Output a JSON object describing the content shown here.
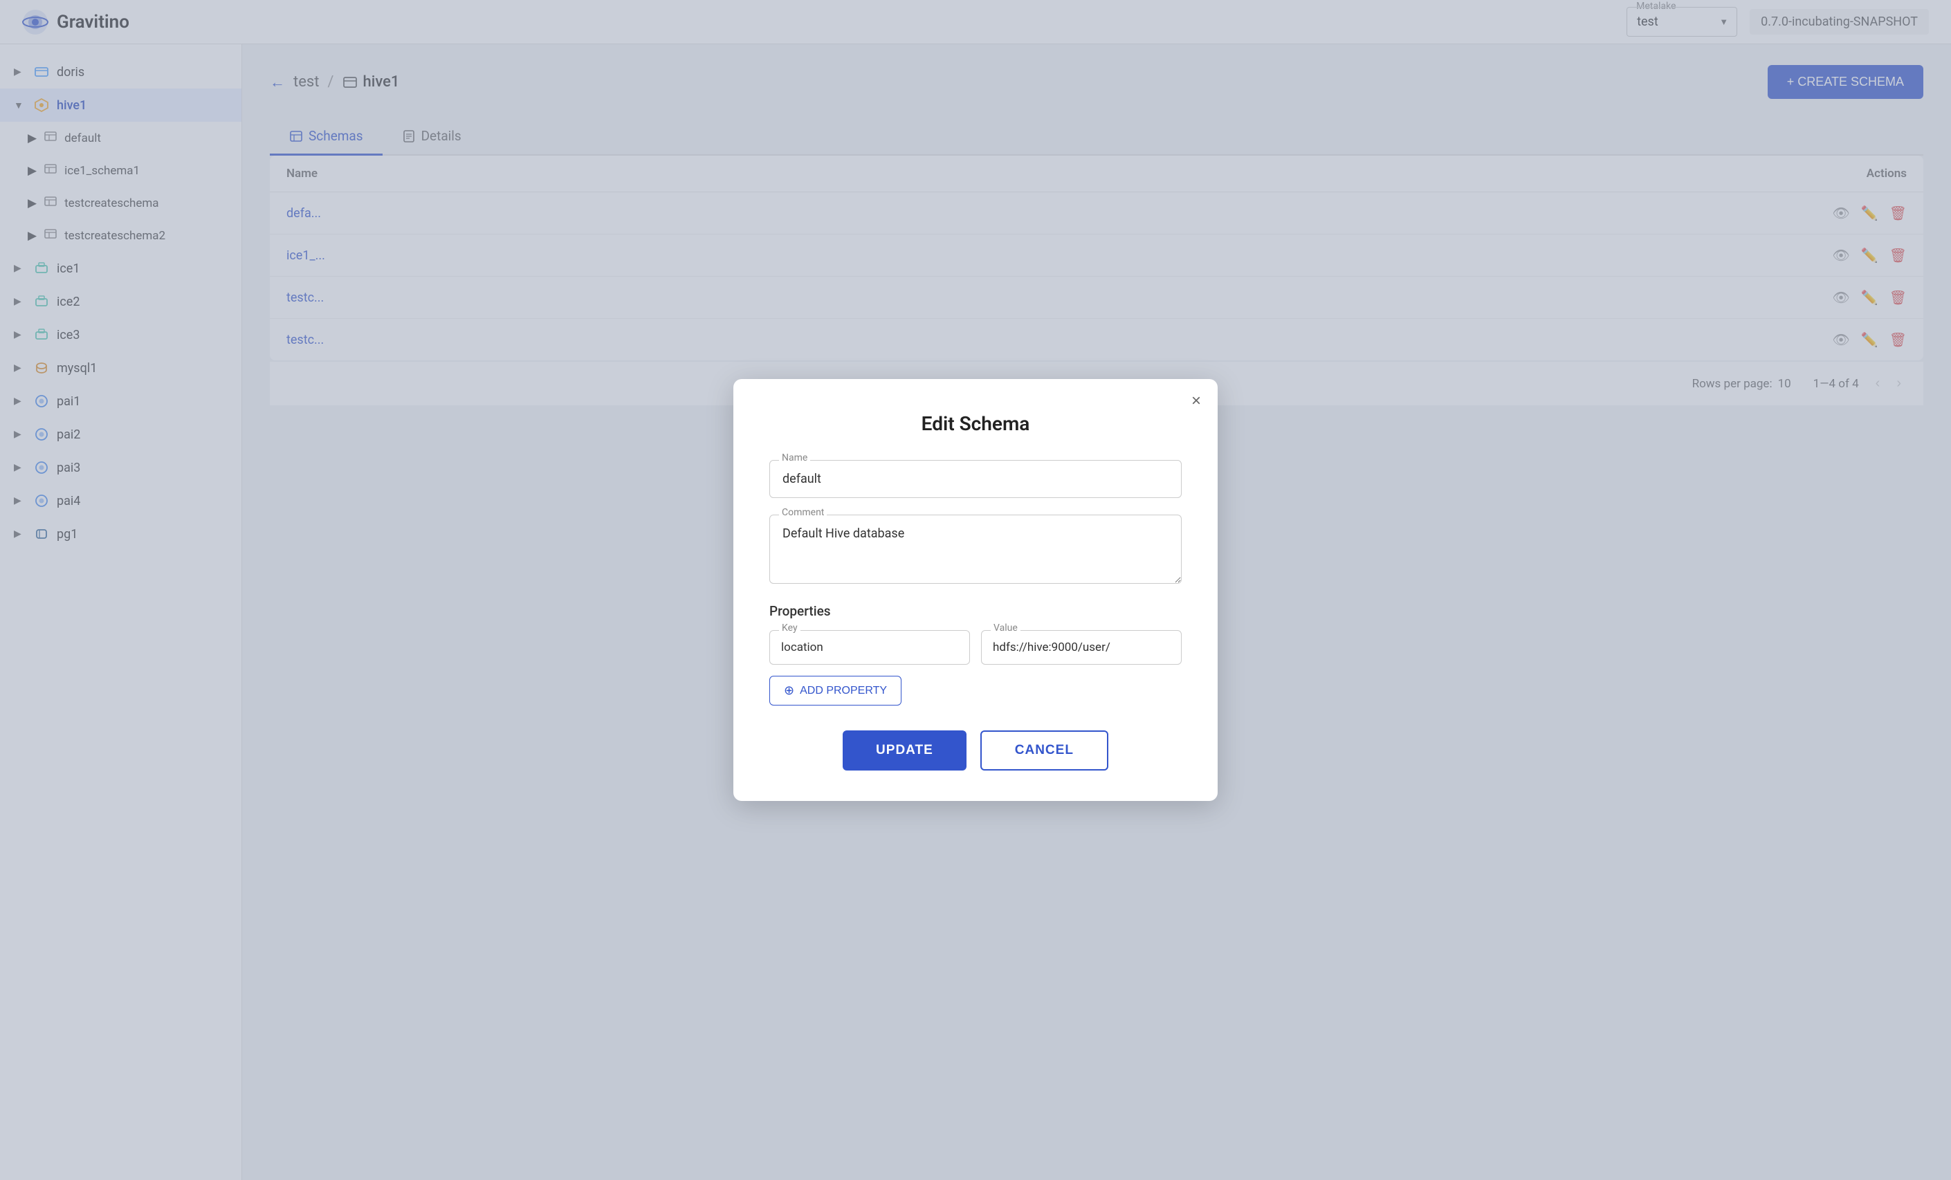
{
  "app": {
    "name": "Gravitino"
  },
  "header": {
    "metalake_label": "Metalake",
    "metalake_value": "test",
    "version": "0.7.0-incubating-SNAPSHOT"
  },
  "sidebar": {
    "items": [
      {
        "id": "doris",
        "label": "doris",
        "icon": "db",
        "expandable": true,
        "expanded": false
      },
      {
        "id": "hive1",
        "label": "hive1",
        "icon": "hive",
        "expandable": true,
        "expanded": true,
        "active": true,
        "children": [
          {
            "id": "default",
            "label": "default",
            "icon": "table"
          },
          {
            "id": "ice1_schema1",
            "label": "ice1_schema1",
            "icon": "table"
          },
          {
            "id": "testcreateschema",
            "label": "testcreateschema",
            "icon": "table"
          },
          {
            "id": "testcreateschema2",
            "label": "testcreateschema2",
            "icon": "table"
          }
        ]
      },
      {
        "id": "ice1",
        "label": "ice1",
        "icon": "iceberg",
        "expandable": true,
        "expanded": false
      },
      {
        "id": "ice2",
        "label": "ice2",
        "icon": "iceberg",
        "expandable": true,
        "expanded": false
      },
      {
        "id": "ice3",
        "label": "ice3",
        "icon": "iceberg",
        "expandable": true,
        "expanded": false
      },
      {
        "id": "mysql1",
        "label": "mysql1",
        "icon": "mysql",
        "expandable": true,
        "expanded": false
      },
      {
        "id": "pai1",
        "label": "pai1",
        "icon": "pai",
        "expandable": true,
        "expanded": false
      },
      {
        "id": "pai2",
        "label": "pai2",
        "icon": "pai",
        "expandable": true,
        "expanded": false
      },
      {
        "id": "pai3",
        "label": "pai3",
        "icon": "pai",
        "expandable": true,
        "expanded": false
      },
      {
        "id": "pai4",
        "label": "pai4",
        "icon": "pai",
        "expandable": true,
        "expanded": false
      },
      {
        "id": "pg1",
        "label": "pg1",
        "icon": "pg",
        "expandable": true,
        "expanded": false
      }
    ]
  },
  "breadcrumb": {
    "back_label": "←",
    "parent": "test",
    "separator": "/",
    "current": "hive1"
  },
  "create_schema_btn": "+ CREATE SCHEMA",
  "tabs": [
    {
      "id": "schemas",
      "label": "Schemas",
      "active": true
    },
    {
      "id": "details",
      "label": "Details",
      "active": false
    }
  ],
  "table": {
    "columns": [
      {
        "id": "name",
        "label": "Name"
      },
      {
        "id": "actions",
        "label": "Actions"
      }
    ],
    "rows": [
      {
        "id": "default",
        "name": "defa..."
      },
      {
        "id": "ice1_schema1",
        "name": "ice1_..."
      },
      {
        "id": "testcreateschema",
        "name": "testc..."
      },
      {
        "id": "testcreateschema2",
        "name": "testc..."
      }
    ],
    "footer": {
      "rows_per_page_label": "Rows per page:",
      "rows_per_page_value": "10",
      "pagination_info": "1—4 of 4"
    }
  },
  "modal": {
    "title": "Edit Schema",
    "close_label": "×",
    "name_label": "Name",
    "name_value": "default",
    "comment_label": "Comment",
    "comment_value": "Default Hive database",
    "properties_label": "Properties",
    "key_label": "Key",
    "key_value": "location",
    "value_label": "Value",
    "value_value": "hdfs://hive:9000/user/",
    "add_property_btn": "ADD PROPERTY",
    "update_btn": "UPDATE",
    "cancel_btn": "CANCEL"
  }
}
